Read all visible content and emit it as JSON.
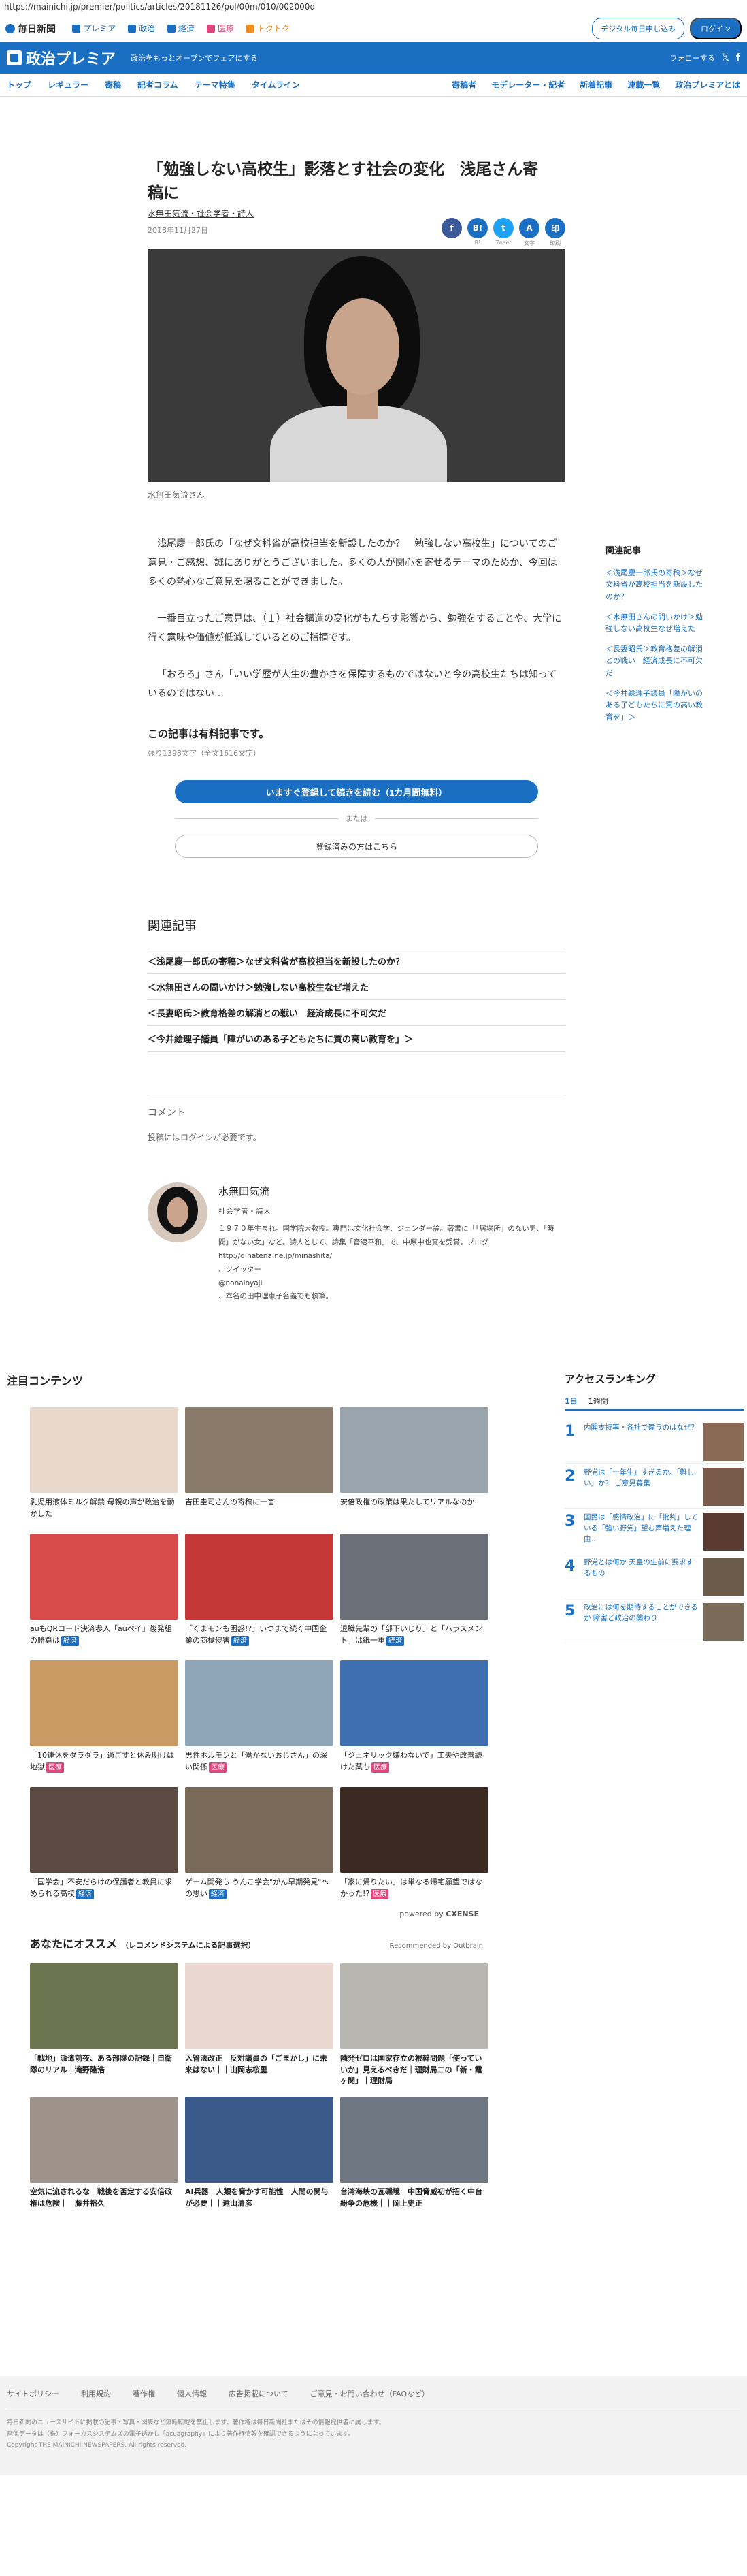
{
  "url": "https://mainichi.jp/premier/politics/articles/20181126/pol/00m/010/002000d",
  "topbar": {
    "logo": "毎日新聞",
    "nav": [
      {
        "label": "プレミア",
        "color": "#1a6fc2"
      },
      {
        "label": "政治",
        "color": "#1a6fc2"
      },
      {
        "label": "経済",
        "color": "#1a6fc2"
      },
      {
        "label": "医療",
        "color": "#e0457b"
      },
      {
        "label": "トクトク",
        "color": "#f08c1c"
      }
    ],
    "subscribe_label": "デジタル毎日申し込み",
    "login_label": "ログイン"
  },
  "brandbar": {
    "title": "政治プレミア",
    "tagline": "政治をもっとオープンでフェアにする",
    "follow": "フォローする"
  },
  "subnav": {
    "left": [
      "トップ",
      "レギュラー",
      "寄稿",
      "記者コラム",
      "テーマ特集",
      "タイムライン"
    ],
    "right": [
      "寄稿者",
      "モデレーター・記者",
      "新着記事",
      "連載一覧",
      "政治プレミアとは"
    ]
  },
  "article": {
    "title": "「勉強しない高校生」影落とす社会の変化　浅尾さん寄稿に",
    "byline": "水無田気流・社会学者・詩人",
    "date": "2018年11月27日",
    "share": [
      {
        "icon": "f",
        "label": ""
      },
      {
        "icon": "B!",
        "label": "B!"
      },
      {
        "icon": "t",
        "label": "Tweet"
      },
      {
        "icon": "A",
        "label": "文字"
      },
      {
        "icon": "印",
        "label": "印刷"
      }
    ],
    "caption": "水無田気流さん",
    "paragraphs": [
      "浅尾慶一郎氏の「なぜ文科省が高校担当を新設したのか？　勉強しない高校生」についてのご意見・ご感想、誠にありがとうございました。多くの人が関心を寄せるテーマのためか、今回は多くの熱心なご意見を賜ることができました。",
      "一番目立ったご意見は、（１）社会構造の変化がもたらす影響から、勉強をすることや、大学に行く意味や価値が低減しているとのご指摘です。",
      "「おろろ」さん「いい学歴が人生の豊かさを保障するものではないと今の高校生たちは知っているのではない…"
    ],
    "paywall_title": "この記事は有料記事です。",
    "paywall_remaining": "残り1393文字（全文1616文字）",
    "subscribe_btn": "いますぐ登録して続きを読む（1カ月間無料）",
    "or": "または",
    "login_btn": "登録済みの方はこちら"
  },
  "side_related": {
    "title": "関連記事",
    "items": [
      "＜浅尾慶一郎氏の寄稿＞なぜ文科省が高校担当を新設したのか？",
      "＜水無田さんの問いかけ＞勉強しない高校生なぜ増えた",
      "＜長妻昭氏＞教育格差の解消との戦い　経済成長に不可欠だ",
      "＜今井絵理子議員「障がいのある子どもたちに質の高い教育を」＞"
    ]
  },
  "related": {
    "title": "関連記事",
    "items": [
      "＜浅尾慶一郎氏の寄稿＞なぜ文科省が高校担当を新設したのか？",
      "＜水無田さんの問いかけ＞勉強しない高校生なぜ増えた",
      "＜長妻昭氏＞教育格差の解消との戦い　経済成長に不可欠だ",
      "＜今井絵理子議員「障がいのある子どもたちに質の高い教育を」＞"
    ]
  },
  "comment": {
    "title": "コメント",
    "note": "投稿にはログインが必要です。"
  },
  "author": {
    "name": "水無田気流",
    "role": "社会学者・詩人",
    "bio": "１９７０年生まれ。国学院大教授。専門は文化社会学、ジェンダー論。著書に「「居場所」のない男、「時間」がない女」など。詩人として、詩集「音速平和」で、中原中也賞を受賞。ブログ",
    "blog": "http://d.hatena.ne.jp/minashita/",
    "twitter_label": "、ツイッター",
    "twitter": "@nonaioyaji",
    "note": "、本名の田中理恵子名義でも執筆。"
  },
  "featured": {
    "title": "注目コンテンツ",
    "cards": [
      {
        "title": "乳児用液体ミルク解禁 母親の声が政治を動かした",
        "tag": "",
        "tag_color": "",
        "bg": "#e9d8cc"
      },
      {
        "title": "吉田圭司さんの寄稿に一言",
        "tag": "",
        "tag_color": "",
        "bg": "#8a7a6a"
      },
      {
        "title": "安倍政権の政策は果たしてリアルなのか",
        "tag": "",
        "tag_color": "",
        "bg": "#9aa4ad"
      },
      {
        "title": "auもQRコード決済参入「auペイ」後発組の勝算は",
        "tag": "経済",
        "tag_color": "#1a6fc2",
        "bg": "#d84b4b"
      },
      {
        "title": "「くまモンも困惑!?」いつまで続く中国企業の商標侵害",
        "tag": "経済",
        "tag_color": "#1a6fc2",
        "bg": "#c43838"
      },
      {
        "title": "退職先輩の「部下いじり」と「ハラスメント」は紙一重",
        "tag": "経済",
        "tag_color": "#1a6fc2",
        "bg": "#6a6f78"
      },
      {
        "title": "「10連休をダラダラ」過ごすと休み明けは地獄",
        "tag": "医療",
        "tag_color": "#e0457b",
        "bg": "#c99a64"
      },
      {
        "title": "男性ホルモンと「働かないおじさん」の深い関係",
        "tag": "医療",
        "tag_color": "#e0457b",
        "bg": "#8fa5b8"
      },
      {
        "title": "「ジェネリック嫌わないで」工夫や改善続けた薬も",
        "tag": "医療",
        "tag_color": "#e0457b",
        "bg": "#3f6fb0"
      },
      {
        "title": "「国学会」不安だらけの保護者と教員に求められる高校",
        "tag": "経済",
        "tag_color": "#1a6fc2",
        "bg": "#5a4a42"
      },
      {
        "title": "ゲーム開発も うんこ学会\"がん早期発見\"への思い",
        "tag": "経済",
        "tag_color": "#1a6fc2",
        "bg": "#7a6a5a"
      },
      {
        "title": "「家に帰りたい」は単なる帰宅願望ではなかった!?",
        "tag": "医療",
        "tag_color": "#e0457b",
        "bg": "#3a2a22"
      }
    ],
    "powered": "powered by",
    "powered_brand": "CXENSE"
  },
  "reco": {
    "title": "あなたにオススメ",
    "sub": "（レコメンドシステムによる記事選択）",
    "ob": "Recommended by Outbrain",
    "cards": [
      {
        "title": "「戦地」派遣前夜、ある部隊の記録｜自衛隊のリアル｜滝野隆浩",
        "bg": "#6d7450"
      },
      {
        "title": "入管法改正　反対議員の「ごまかし」に未来はない｜｜山岡志桜里",
        "bg": "#ead7cf"
      },
      {
        "title": "隣発ゼロは国家存立の根幹問題「使っていいか」見えるべきだ｜理財局二の「新・霞ヶ関」｜理財局",
        "bg": "#b8b6b0"
      },
      {
        "title": "空気に流されるな　戦後を否定する安倍政権は危険｜｜藤井裕久",
        "bg": "#9e938a"
      },
      {
        "title": "AI兵器　人類を脅かす可能性　人間の関与が必要｜｜遠山清彦",
        "bg": "#3a5a8c"
      },
      {
        "title": "台湾海峡の瓦礫境　中国脅威初が招く中台紛争の危機｜｜岡上史正",
        "bg": "#6e7682"
      }
    ]
  },
  "ranking": {
    "title": "アクセスランキング",
    "tabs": [
      "1日",
      "1週間"
    ],
    "items": [
      {
        "rank": "1",
        "title": "内閣支持率・各社で違うのはなぜ？",
        "bg": "#8a6a55"
      },
      {
        "rank": "2",
        "title": "野党は「一年生」すぎるか。「難しい」か？ ご意見募集",
        "bg": "#7a5a4a"
      },
      {
        "rank": "3",
        "title": "国民は「感情政治」に「批判」している「強い野党」望む声増えた理由…",
        "bg": "#5a3a30"
      },
      {
        "rank": "4",
        "title": "野党とは何か 天皇の生前に要求するもの",
        "bg": "#6a5a4a"
      },
      {
        "rank": "5",
        "title": "政治には何を期待することができるか 障害と政治の関わり",
        "bg": "#7a6a5a"
      }
    ]
  },
  "footer": {
    "links": [
      "サイトポリシー",
      "利用規約",
      "著作権",
      "個人情報",
      "広告掲載について",
      "ご意見・お問い合わせ（FAQなど）"
    ],
    "note1": "毎日新聞のニュースサイトに掲載の記事・写真・図表など無断転載を禁止します。著作権は毎日新聞社またはその情報提供者に属します。",
    "note2": "画像データは（株）フォーカスシステムズの電子透かし「acuagraphy」により著作権情報を確認できるようになっています。",
    "copyright": "Copyright THE MAINICHI NEWSPAPERS. All rights reserved."
  }
}
